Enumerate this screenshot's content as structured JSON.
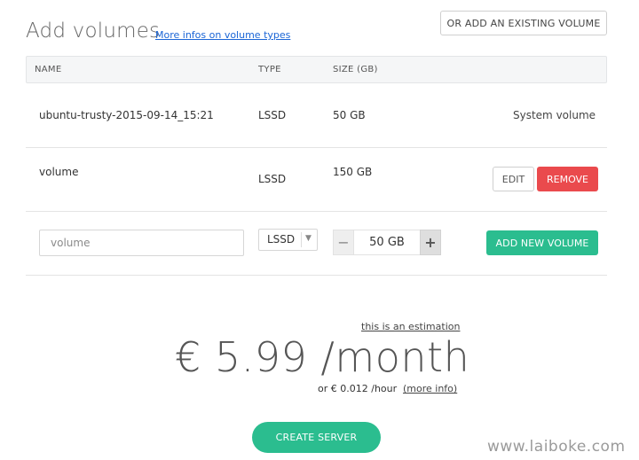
{
  "header": {
    "title": "Add volumes",
    "info_link": "More infos on volume types",
    "existing_button": "OR ADD AN EXISTING VOLUME"
  },
  "table": {
    "columns": [
      "NAME",
      "TYPE",
      "SIZE (GB)"
    ],
    "rows": [
      {
        "name": "ubuntu-trusty-2015-09-14_15:21",
        "type": "LSSD",
        "size": "50 GB",
        "note": "System volume"
      },
      {
        "name": "volume",
        "type": "LSSD",
        "size": "150 GB",
        "edit_label": "EDIT",
        "remove_label": "REMOVE"
      }
    ]
  },
  "new_volume": {
    "name_placeholder": "volume",
    "type_selected": "LSSD",
    "size_value": "50 GB",
    "minus_symbol": "−",
    "plus_symbol": "+",
    "add_label": "ADD NEW VOLUME"
  },
  "pricing": {
    "estimation_note": "this is an estimation",
    "price": "€ 5.99 /month",
    "hourly": "or € 0.012 /hour",
    "more_info": "(more info)"
  },
  "create_label": "CREATE SERVER",
  "watermark": "www.laiboke.com",
  "colors": {
    "accent": "#2bbd8f",
    "danger": "#ea4a4d",
    "link": "#1a65d6"
  }
}
